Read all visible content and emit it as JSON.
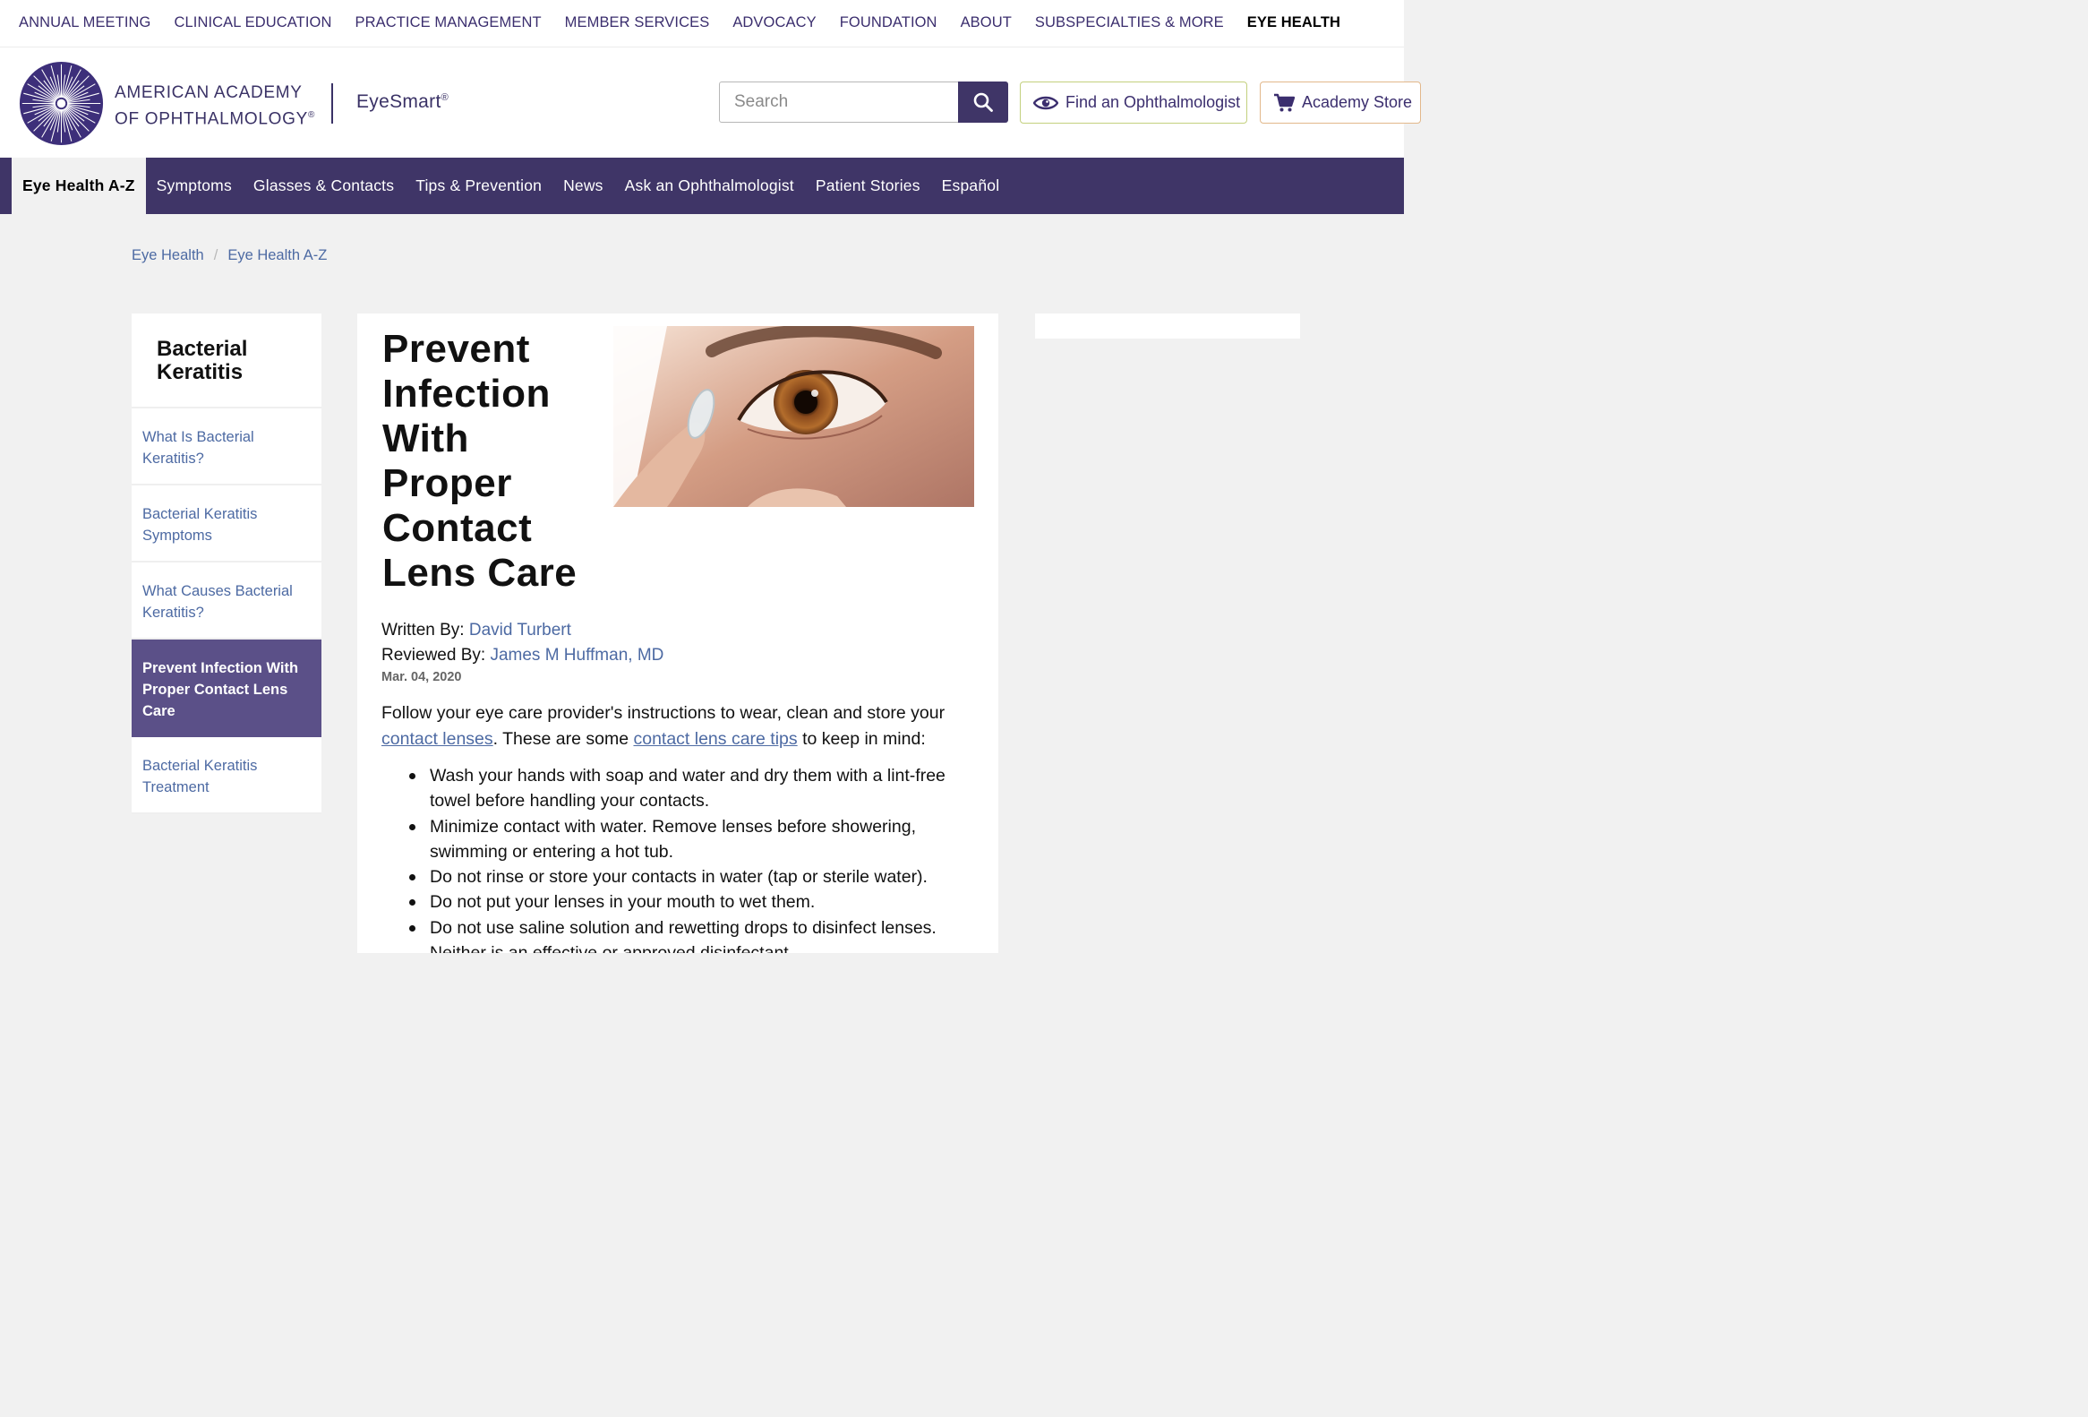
{
  "utility_nav": {
    "items": [
      {
        "label": "ANNUAL MEETING"
      },
      {
        "label": "CLINICAL EDUCATION"
      },
      {
        "label": "PRACTICE MANAGEMENT"
      },
      {
        "label": "MEMBER SERVICES"
      },
      {
        "label": "ADVOCACY"
      },
      {
        "label": "FOUNDATION"
      },
      {
        "label": "ABOUT"
      },
      {
        "label": "SUBSPECIALTIES & MORE"
      },
      {
        "label": "EYE HEALTH"
      }
    ],
    "active": "EYE HEALTH"
  },
  "header": {
    "logo_line1": "AMERICAN ACADEMY",
    "logo_line2": "OF OPHTHALMOLOGY",
    "logo_reg": "®",
    "site_name": "EyeSmart",
    "site_reg": "®",
    "search_placeholder": "Search",
    "search_value": "",
    "find_label": "Find an Ophthalmologist",
    "store_label": "Academy Store"
  },
  "main_nav": {
    "items": [
      {
        "label": "Eye Health A-Z"
      },
      {
        "label": "Symptoms"
      },
      {
        "label": "Glasses & Contacts"
      },
      {
        "label": "Tips & Prevention"
      },
      {
        "label": "News"
      },
      {
        "label": "Ask an Ophthalmologist"
      },
      {
        "label": "Patient Stories"
      },
      {
        "label": "Español"
      }
    ],
    "active": "Eye Health A-Z"
  },
  "breadcrumb": {
    "items": [
      "Eye Health",
      "Eye Health A-Z"
    ],
    "separator": "/"
  },
  "sidebar": {
    "title": "Bacterial Keratitis",
    "items": [
      {
        "label": "What Is Bacterial Keratitis?"
      },
      {
        "label": "Bacterial Keratitis Symptoms"
      },
      {
        "label": "What Causes Bacterial Keratitis?"
      },
      {
        "label": "Prevent Infection With Proper Contact Lens Care"
      },
      {
        "label": "Bacterial Keratitis Treatment"
      }
    ],
    "active": "Prevent Infection With Proper Contact Lens Care"
  },
  "article": {
    "title": "Prevent Infection With Proper Contact Lens Care",
    "written_by_label": "Written By:",
    "author": "David Turbert",
    "reviewed_by_label": "Reviewed By:",
    "reviewer": "James M Huffman, MD",
    "date": "Mar. 04, 2020",
    "intro_1": "Follow your eye care provider's instructions to wear, clean and store your ",
    "intro_link_1": "contact lenses",
    "intro_2": ". These are some ",
    "intro_link_2": "contact lens care tips",
    "intro_3": " to keep in mind:",
    "tips": [
      "Wash your hands with soap and water and dry them with a lint-free towel before handling your contacts.",
      "Minimize contact with water. Remove lenses before showering, swimming or entering a hot tub.",
      "Do not rinse or store your contacts in water (tap or sterile water).",
      "Do not put your lenses in your mouth to wet them.",
      "Do not use saline solution and rewetting drops to disinfect lenses. Neither is an effective or approved disinfectant."
    ]
  },
  "colors": {
    "brand_purple": "#3f3567",
    "sidebar_active": "#5b5088",
    "link_blue": "#4d6aa3",
    "page_bg": "#f1f1f1",
    "find_border": "#c3d07e",
    "store_border": "#e2b88b"
  },
  "icons": {
    "logo": "starburst-logo-icon",
    "search": "search-icon",
    "find": "eye-icon",
    "store": "cart-icon"
  }
}
